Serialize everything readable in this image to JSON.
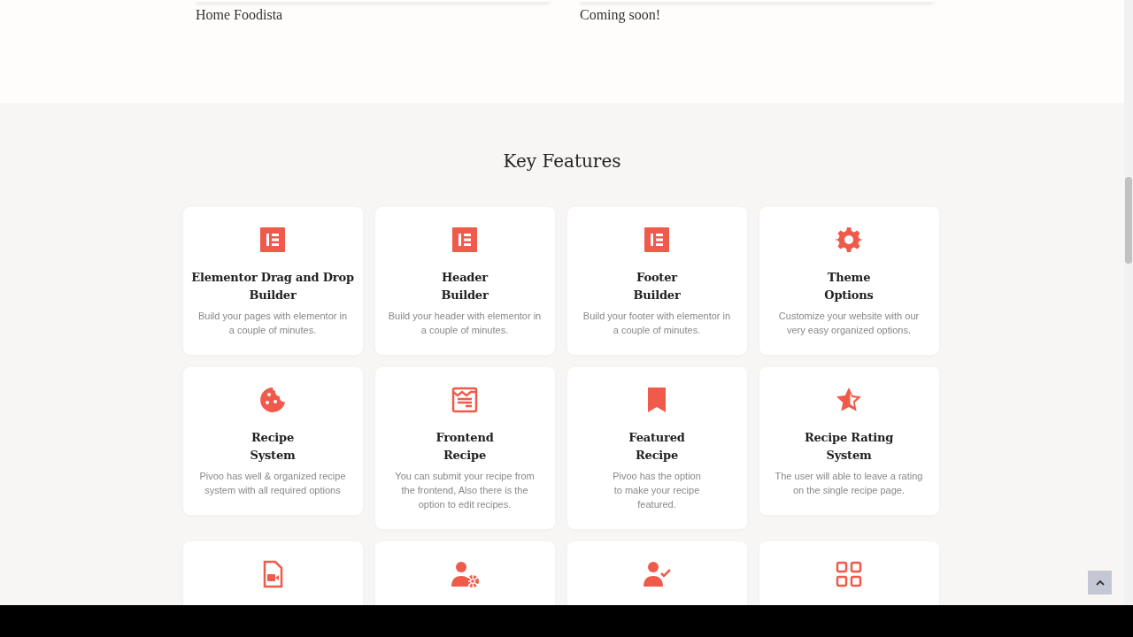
{
  "demos": [
    {
      "caption": "Home Foodista"
    },
    {
      "caption": "Coming soon!"
    }
  ],
  "features_section": {
    "heading": "Key Features",
    "features": [
      {
        "kind": "full",
        "title": "Elementor Drag and Drop\nBuilder",
        "description": "Build your pages with elementor in\na couple of minutes."
      },
      {
        "kind": "full",
        "title": "Header\nBuilder",
        "description": "Build your header with elementor in\na couple of minutes."
      },
      {
        "kind": "full",
        "title": "Footer\nBuilder",
        "description": "Build your footer with elementor in\na couple of minutes."
      },
      {
        "kind": "full",
        "title": "Theme\nOptions",
        "description": "Customize your website with our\nvery easy organized options."
      },
      {
        "kind": "full",
        "title": "Recipe\nSystem",
        "description": "Pivoo has well & organized recipe\nsystem with all required options"
      },
      {
        "kind": "full",
        "title": "Frontend\nRecipe",
        "description": "You can submit your recipe from\nthe frontend, Also there is the\noption to edit recipes."
      },
      {
        "kind": "full",
        "title": "Featured\nRecipe",
        "description": "Pivoo has the option\nto make your recipe\nfeatured."
      },
      {
        "kind": "full",
        "title": "Recipe Rating\nSystem",
        "description": "The user will able to leave a rating\non the single recipe page."
      },
      {
        "kind": "icon_only"
      },
      {
        "kind": "icon_only"
      },
      {
        "kind": "icon_only"
      },
      {
        "kind": "icon_only"
      }
    ]
  }
}
